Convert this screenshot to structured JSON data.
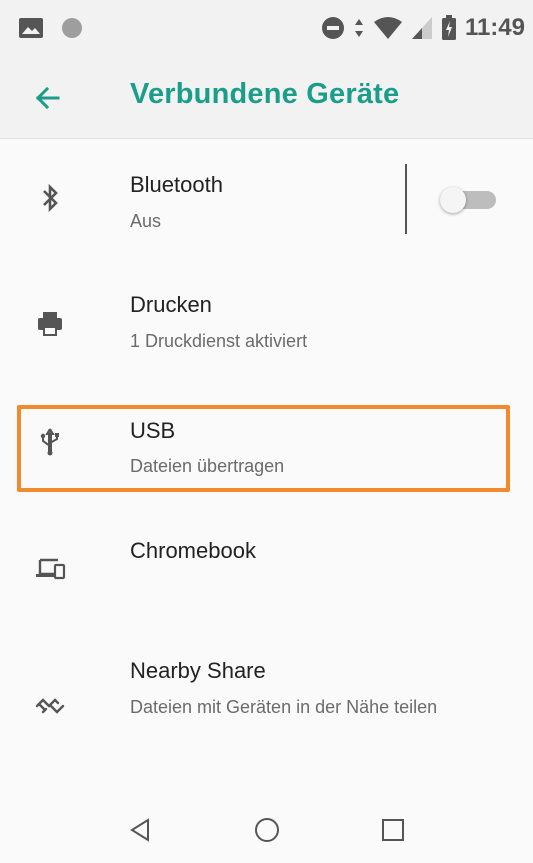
{
  "status_bar": {
    "time": "11:49",
    "icons": [
      "image-icon",
      "circle-icon",
      "do-not-disturb-icon",
      "data-arrows-icon",
      "wifi-icon",
      "signal-icon",
      "battery-icon"
    ]
  },
  "app_bar": {
    "title": "Verbundene Geräte",
    "back_icon": "arrow-left-icon",
    "accent_color": "#1a9e8a"
  },
  "items": [
    {
      "title": "Bluetooth",
      "subtitle": "Aus",
      "icon": "bluetooth-icon",
      "toggle": "off"
    },
    {
      "title": "Drucken",
      "subtitle": "1 Druckdienst aktiviert",
      "icon": "printer-icon"
    },
    {
      "title": "USB",
      "subtitle": "Dateien übertragen",
      "icon": "usb-icon",
      "highlighted": true
    },
    {
      "title": "Chromebook",
      "subtitle": "",
      "icon": "devices-icon"
    },
    {
      "title": "Nearby Share",
      "subtitle": "Dateien mit Geräten in der Nähe teilen",
      "icon": "nearby-share-icon"
    }
  ],
  "highlight_color": "#f08a2c",
  "nav_bar": {
    "buttons": [
      "back-triangle-icon",
      "home-circle-icon",
      "recents-square-icon"
    ]
  }
}
